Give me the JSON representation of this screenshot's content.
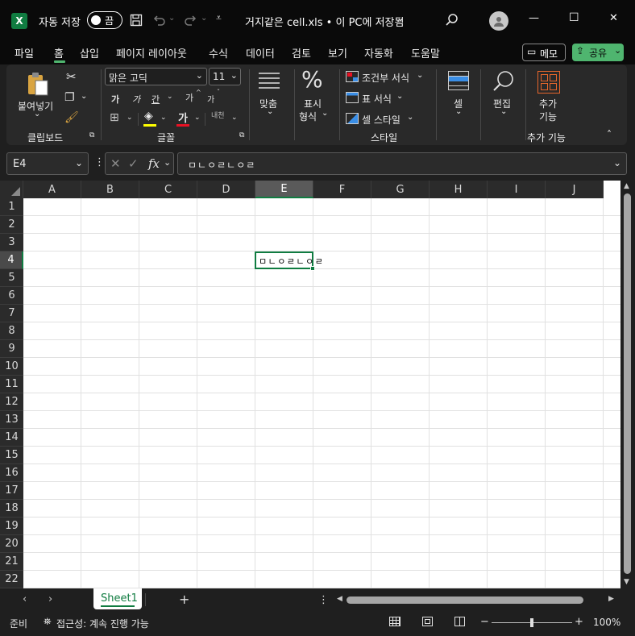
{
  "titlebar": {
    "autosave_label": "자동 저장",
    "autosave_state": "끔",
    "filename": "거지같은 cell.xls • 이 PC에 저장됨",
    "minimize": "—",
    "maximize": "☐",
    "close": "✕"
  },
  "menu": {
    "items": [
      "파일",
      "홈",
      "삽입",
      "페이지 레이아웃",
      "수식",
      "데이터",
      "검토",
      "보기",
      "자동화",
      "도움말"
    ],
    "active": "홈",
    "memo_label": "메모",
    "share_label": "공유"
  },
  "ribbon": {
    "paste_label": "붙여넣기",
    "clipboard_label": "클립보드",
    "font_name": "맑은 고딕",
    "font_size": "11",
    "font_label": "글꼴",
    "grow_font": "가",
    "shrink_font": "가",
    "underline_font": "간",
    "super_a": "가",
    "super_b": "가",
    "font_color_glyph": "가",
    "phonetic_label": "내천",
    "align_label": "맞춤",
    "number_label_1": "표시",
    "number_label_2": "형식",
    "percent_glyph": "%",
    "cond_format_label": "조건부 서식",
    "table_format_label": "표 서식",
    "cell_style_label": "셀 스타일",
    "style_group_label": "스타일",
    "cells_label": "셀",
    "edit_label": "편집",
    "addin_label_1": "추가",
    "addin_label_2": "기능",
    "addin_group_label": "추가 기능",
    "highlight_color": "#ffff00",
    "font_color": "#e81123"
  },
  "formula": {
    "name_box": "E4",
    "fx": "fx",
    "content": "ㅁㄴㅇㄹㄴㅇㄹ"
  },
  "grid": {
    "columns": [
      "A",
      "B",
      "C",
      "D",
      "E",
      "F",
      "G",
      "H",
      "I",
      "J"
    ],
    "rows": [
      "1",
      "2",
      "3",
      "4",
      "5",
      "6",
      "7",
      "8",
      "9",
      "10",
      "11",
      "12",
      "13",
      "14",
      "15",
      "16",
      "17",
      "18",
      "19",
      "20",
      "21",
      "22"
    ],
    "selected_cell": "E4",
    "cell_e4": "ㅁㄴㅇㄹㄴㅇㄹ",
    "selection_color": "#107c41"
  },
  "sheets": {
    "tabs": [
      "Sheet1"
    ],
    "add": "+"
  },
  "status": {
    "ready": "준비",
    "accessibility": "접근성: 계속 진행 가능",
    "zoom": "100%",
    "zoom_minus": "−",
    "zoom_plus": "+"
  }
}
